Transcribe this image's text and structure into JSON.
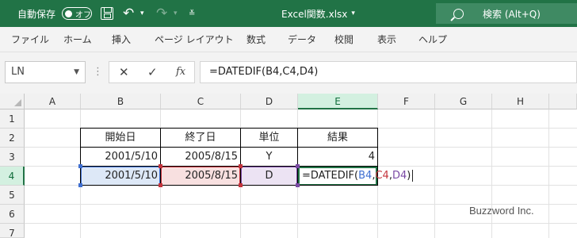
{
  "titlebar": {
    "autosave_label": "自動保存",
    "autosave_state": "オフ",
    "filename": "Excel関数.xlsx",
    "filename_caret": "▾",
    "search_placeholder": "検索 (Alt+Q)"
  },
  "menu": [
    "ファイル",
    "ホーム",
    "挿入",
    "ページ レイアウト",
    "数式",
    "データ",
    "校閲",
    "表示",
    "ヘルプ"
  ],
  "formula_bar": {
    "name_box": "LN",
    "formula": "=DATEDIF(B4,C4,D4)"
  },
  "columns": [
    "A",
    "B",
    "C",
    "D",
    "E",
    "F",
    "G",
    "H"
  ],
  "rows": [
    "1",
    "2",
    "3",
    "4",
    "5",
    "6",
    "7"
  ],
  "table": {
    "headers": [
      "開始日",
      "終了日",
      "単位",
      "結果"
    ],
    "row3": [
      "2001/5/10",
      "2005/8/15",
      "Y",
      "4"
    ],
    "row4": [
      "2001/5/10",
      "2005/8/15",
      "D"
    ]
  },
  "edit_formula": {
    "prefix": "=DATEDIF(",
    "ref1": "B4",
    "sep1": ",",
    "ref2": "C4",
    "sep2": ",",
    "ref3": "D4",
    "suffix": ")"
  },
  "colors": {
    "accent": "#217346",
    "ref_b": "#3f6fd1",
    "ref_c": "#c4343c",
    "ref_d": "#7a4aa4"
  },
  "watermark": "Buzzword Inc."
}
